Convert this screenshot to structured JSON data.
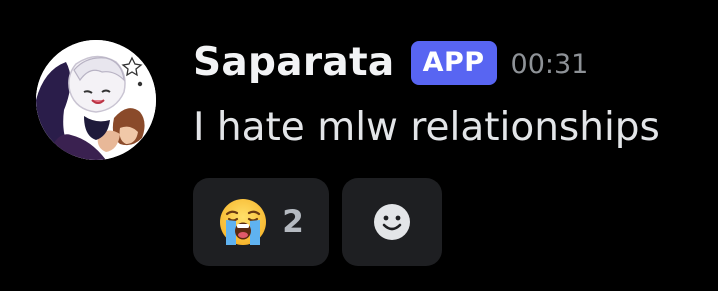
{
  "message": {
    "author": {
      "username": "Saparata",
      "badge": "APP",
      "avatar_icon": "anime-character-avatar"
    },
    "timestamp": "00:31",
    "text": "I hate mlw relationships"
  },
  "reactions": [
    {
      "emoji_icon": "loudly-crying-face-emoji",
      "count": "2"
    }
  ],
  "add_reaction": {
    "icon": "smiley-face-icon"
  },
  "colors": {
    "background": "#000000",
    "badge": "#5865f2",
    "reaction_pill": "#1e1f22",
    "username": "#f2f3f5",
    "timestamp": "#8e9297"
  }
}
